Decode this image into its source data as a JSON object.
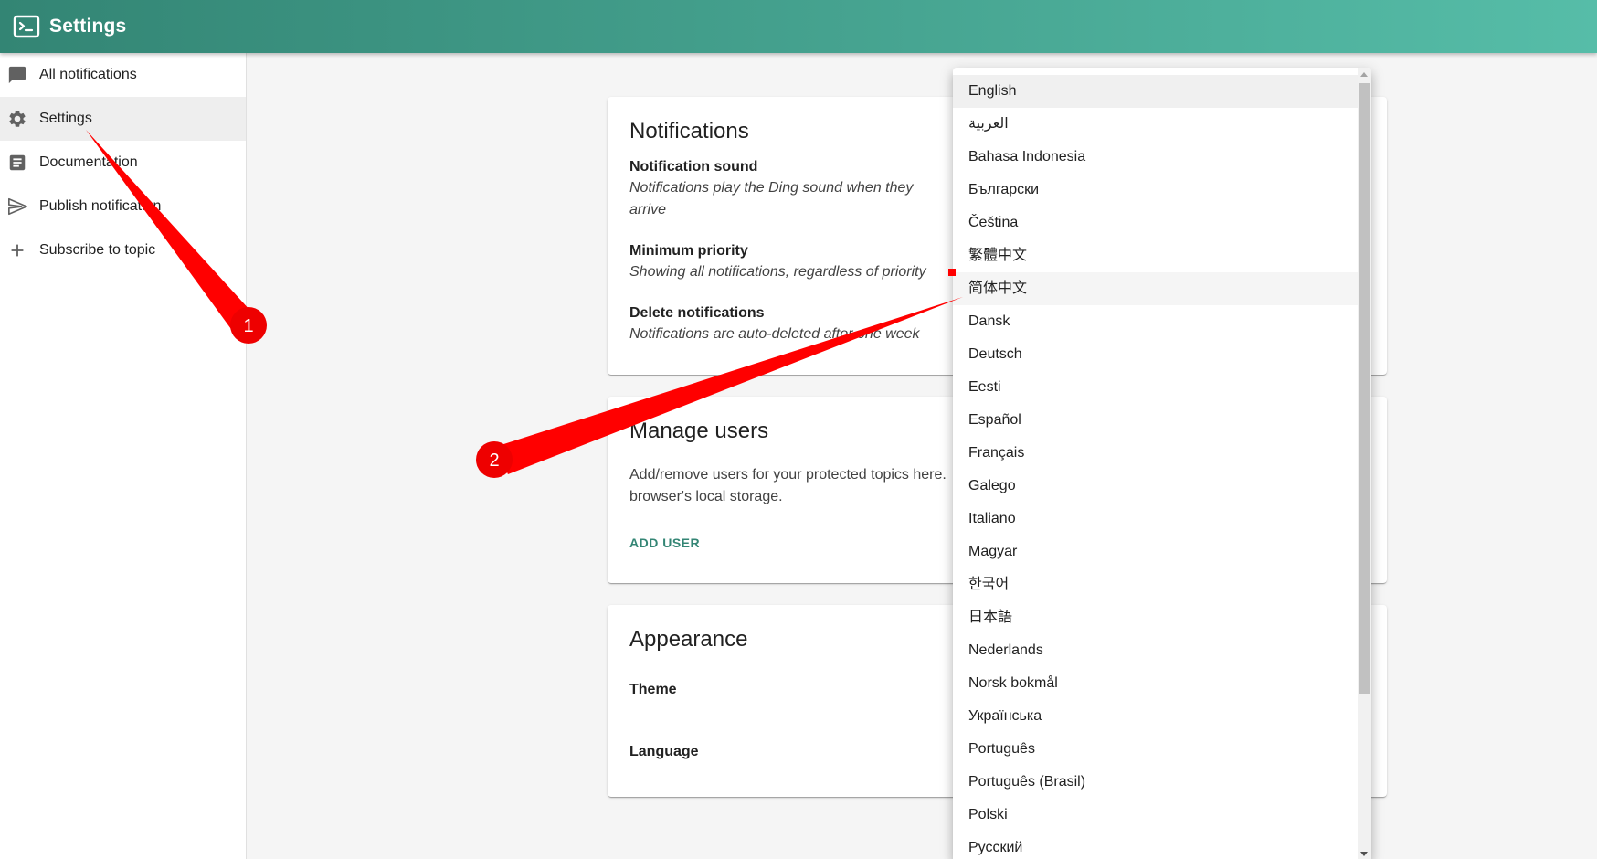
{
  "app": {
    "title": "Settings"
  },
  "sidebar": {
    "items": [
      {
        "label": "All notifications",
        "icon": "chat-bubble-icon"
      },
      {
        "label": "Settings",
        "icon": "gear-icon"
      },
      {
        "label": "Documentation",
        "icon": "document-icon"
      },
      {
        "label": "Publish notification",
        "icon": "send-icon"
      },
      {
        "label": "Subscribe to topic",
        "icon": "plus-icon"
      }
    ],
    "active_index": 1
  },
  "notifications_card": {
    "title": "Notifications",
    "settings": [
      {
        "label": "Notification sound",
        "desc": "Notifications play the Ding sound when they arrive"
      },
      {
        "label": "Minimum priority",
        "desc": "Showing all notifications, regardless of priority"
      },
      {
        "label": "Delete notifications",
        "desc": "Notifications are auto-deleted after one week"
      }
    ]
  },
  "users_card": {
    "title": "Manage users",
    "text": "Add/remove users for your protected topics here. browser's local storage.",
    "add_user_label": "ADD USER"
  },
  "appearance_card": {
    "title": "Appearance",
    "theme_label": "Theme",
    "language_label": "Language"
  },
  "language_menu": {
    "options": [
      "English",
      "العربية",
      "Bahasa Indonesia",
      "Български",
      "Čeština",
      "繁體中文",
      "简体中文",
      "Dansk",
      "Deutsch",
      "Eesti",
      "Español",
      "Français",
      "Galego",
      "Italiano",
      "Magyar",
      "한국어",
      "日本語",
      "Nederlands",
      "Norsk bokmål",
      "Українська",
      "Português",
      "Português (Brasil)",
      "Polski",
      "Русский"
    ],
    "selected": "English",
    "hovered": "简体中文"
  },
  "annotations": {
    "step1": "1",
    "step2": "2"
  },
  "colors": {
    "accent": "#338574",
    "header_start": "#338574",
    "header_end": "#56bda8",
    "annotation": "#ff0000"
  }
}
